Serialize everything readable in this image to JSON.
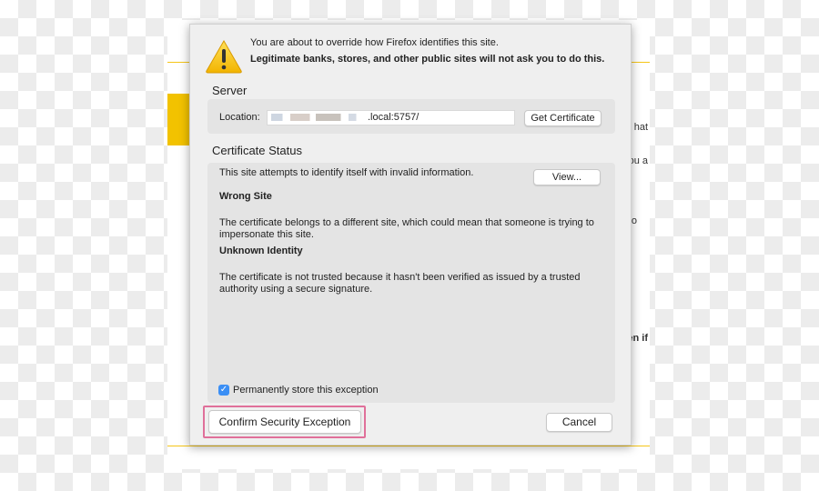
{
  "background_page": {
    "fragments": [
      "hat",
      "you a",
      "to",
      "en if"
    ],
    "accent": "#f5c518"
  },
  "dialog": {
    "message": "You are about to override how Firefox identifies this site.",
    "warning": "Legitimate banks, stores, and other public sites will not ask you to do this.",
    "server": {
      "heading": "Server",
      "location_label": "Location:",
      "location_value": ".local:5757/",
      "get_certificate": "Get Certificate"
    },
    "status": {
      "heading": "Certificate Status",
      "intro": "This site attempts to identify itself with invalid information.",
      "view": "View...",
      "items": [
        {
          "title": "Wrong Site",
          "text": "The certificate belongs to a different site, which could mean that someone is trying to impersonate this site."
        },
        {
          "title": "Unknown Identity",
          "text": "The certificate is not trusted because it hasn't been verified as issued by a trusted authority using a secure signature."
        }
      ]
    },
    "permanent": {
      "label": "Permanently store this exception",
      "checked": true
    },
    "confirm": "Confirm Security Exception",
    "cancel": "Cancel",
    "highlight_color": "#e0709a"
  }
}
